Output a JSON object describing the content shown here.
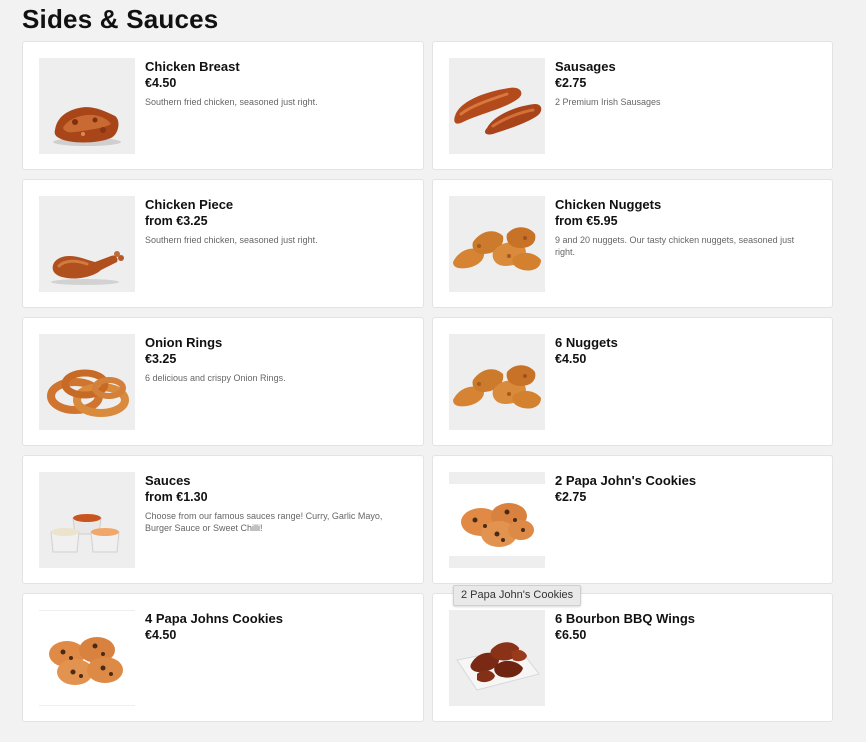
{
  "section": {
    "title": "Sides & Sauces"
  },
  "items": [
    {
      "name": "Chicken Breast",
      "price": "€4.50",
      "desc": "Southern fried chicken, seasoned just right.",
      "image": "chicken-breast-image"
    },
    {
      "name": "Sausages",
      "price": "€2.75",
      "desc": "2 Premium Irish Sausages",
      "image": "sausages-image"
    },
    {
      "name": "Chicken Piece",
      "price": "from €3.25",
      "desc": "Southern fried chicken, seasoned just right.",
      "image": "chicken-piece-image"
    },
    {
      "name": "Chicken Nuggets",
      "price": "from €5.95",
      "desc": "9 and 20 nuggets. Our tasty chicken nuggets, seasoned just right.",
      "image": "chicken-nuggets-image"
    },
    {
      "name": "Onion Rings",
      "price": "€3.25",
      "desc": "6 delicious and crispy Onion Rings.",
      "image": "onion-rings-image"
    },
    {
      "name": "6 Nuggets",
      "price": "€4.50",
      "desc": "",
      "image": "nuggets-image"
    },
    {
      "name": "Sauces",
      "price": "from €1.30",
      "desc": "Choose from our famous sauces range! Curry, Garlic Mayo, Burger Sauce or Sweet Chilli!",
      "image": "sauces-image"
    },
    {
      "name": "2 Papa John's Cookies",
      "price": "€2.75",
      "desc": "",
      "image": "cookies-image"
    },
    {
      "name": "4 Papa Johns Cookies",
      "price": "€4.50",
      "desc": "",
      "image": "cookies-image"
    },
    {
      "name": "6 Bourbon BBQ Wings",
      "price": "€6.50",
      "desc": "",
      "image": "bbq-wings-image"
    }
  ],
  "tooltip": {
    "text": "2 Papa John's Cookies"
  },
  "colors": {
    "page_background": "#f2f2f2",
    "card_background": "#ffffff",
    "thumb_background": "#eeeeee",
    "fried_food": "#c8652a"
  }
}
